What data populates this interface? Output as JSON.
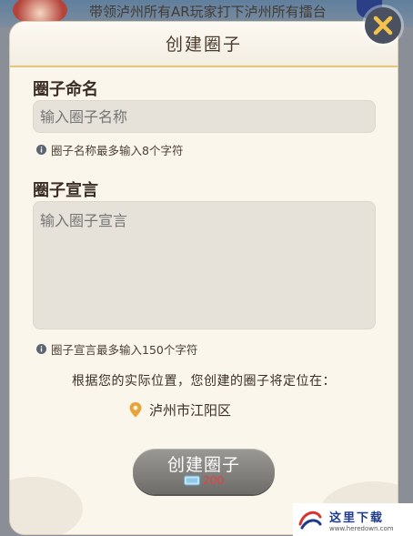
{
  "background": {
    "banner_text": "带领泸州所有AR玩家打下泸州所有擂台"
  },
  "dialog": {
    "title": "创建圈子",
    "name_label": "圈子命名",
    "name_placeholder": "输入圈子名称",
    "name_hint": "圈子名称最多输入8个字符",
    "declaration_label": "圈子宣言",
    "declaration_placeholder": "输入圈子宣言",
    "declaration_hint": "圈子宣言最多输入150个字符",
    "location_notice": "根据您的实际位置，您创建的圈子将定位在：",
    "location_value": "泸州市江阳区",
    "create_button_label": "创建圈子",
    "cost_value": "200"
  },
  "watermark": {
    "text": "这里下载",
    "url": "www.heredown.com"
  },
  "colors": {
    "dialog_bg": "#fbf6ec",
    "header_border": "#e2c680",
    "button_gray": "#858380",
    "cost_red": "#e8403c",
    "close_x": "#f5c24a"
  }
}
